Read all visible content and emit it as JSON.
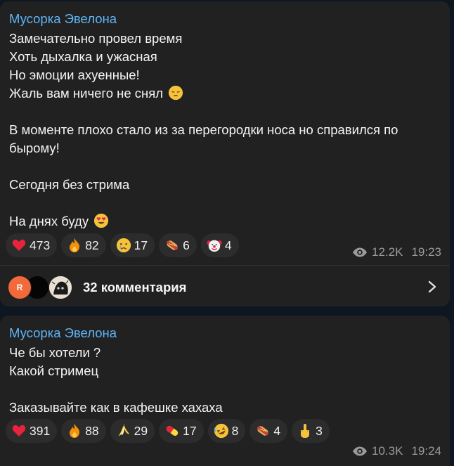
{
  "posts": [
    {
      "channel": "Мусорка Эвелона",
      "lines": {
        "l1": "Замечательно провел время",
        "l2": "Хоть дыхалка и ужасная",
        "l3": "Но эмоции ахуенные!",
        "l4": "Жаль вам ничего не снял",
        "l5": "В моменте плохо стало из за перегородки носа но справился по бырому!",
        "l6": "Сегодня без стрима",
        "l7": "На днях буду"
      },
      "emojis": {
        "l4": "pensive-face",
        "l7": "heart-eyes-face"
      },
      "reactions": [
        {
          "icon": "heart",
          "count": "473"
        },
        {
          "icon": "fire",
          "count": "82"
        },
        {
          "icon": "crying-face",
          "count": "17"
        },
        {
          "icon": "hot-dog",
          "count": "6"
        },
        {
          "icon": "clown-face",
          "count": "4"
        }
      ],
      "views": "12.2K",
      "time": "19:23",
      "comments": {
        "avatar_letter": "R",
        "label": "32 комментария"
      }
    },
    {
      "channel": "Мусорка Эвелона",
      "lines": {
        "l1": "Че бы хотели ?",
        "l2": "Какой стримец",
        "l3": "Заказывайте как в кафешке хахаха"
      },
      "reactions": [
        {
          "icon": "heart",
          "count": "391"
        },
        {
          "icon": "fire",
          "count": "88"
        },
        {
          "icon": "banana",
          "count": "29"
        },
        {
          "icon": "pill",
          "count": "17"
        },
        {
          "icon": "rolling-laughing-face",
          "count": "8"
        },
        {
          "icon": "hot-dog",
          "count": "4"
        },
        {
          "icon": "middle-finger",
          "count": "3"
        }
      ],
      "views": "10.3K",
      "time": "19:24"
    }
  ],
  "colors": {
    "background": "#0e1621",
    "bubble": "#212121",
    "channel_name": "#5eb5f7",
    "reaction_bg": "#2c2c2c",
    "meta": "#9a9a9a",
    "avatar_r": "#f26a3b"
  }
}
